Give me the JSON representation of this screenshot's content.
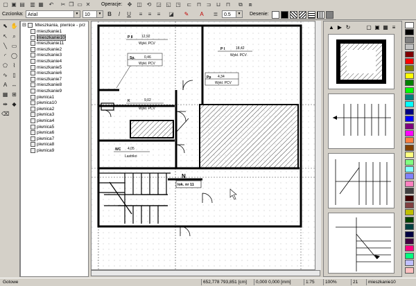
{
  "toolbar": {
    "operations_label": "Operacje:",
    "font_label": "Czcionka:",
    "font_value": "Arial",
    "size_value": "10",
    "line_width_value": "0.5",
    "hatch_label": "Desenie:",
    "bold": "B",
    "italic": "I",
    "underline": "U"
  },
  "tree": {
    "root": "Mieszkania, piwnice - prz",
    "items": [
      "mieszkanie1",
      "mieszkanie10",
      "mieszkanie11",
      "mieszkanie2",
      "mieszkanie3",
      "mieszkanie4",
      "mieszkanie5",
      "mieszkanie6",
      "mieszkanie7",
      "mieszkanie8",
      "mieszkanie9",
      "piwnica1",
      "piwnica10",
      "piwnica2",
      "piwnica3",
      "piwnica4",
      "piwnica5",
      "piwnica6",
      "piwnica7",
      "piwnica8",
      "piwnica9"
    ],
    "selected_index": 1
  },
  "plan": {
    "rooms": [
      {
        "code": "P II",
        "area": "12,92",
        "finish": "Wykł. PCV"
      },
      {
        "code": "P I",
        "area": "18,42",
        "finish": "Wykł. PCV"
      },
      {
        "code": "Sp.",
        "area": "0,46",
        "finish": "Wykł. PCV"
      },
      {
        "code": "Pp",
        "area": "4,34",
        "finish": "Wykł. PCV"
      },
      {
        "code": "K",
        "area": "9,02",
        "finish": "Wykł. PCV"
      },
      {
        "code": "WC",
        "area": "4,05",
        "finish": "Lastriko"
      }
    ],
    "entrance_label": "N",
    "apartment_label": "lok. nr 11"
  },
  "status": {
    "state": "Gotowe",
    "coords": "652,778  793,851 [cm]",
    "offset": "0,000  0,000 [mm]",
    "scale": "1:75",
    "zoom": "100%",
    "count": "21",
    "selected": "mieszkanie10"
  },
  "palette": [
    "#ffffff",
    "#000000",
    "#808080",
    "#c0c0c0",
    "#800000",
    "#ff0000",
    "#808000",
    "#ffff00",
    "#008000",
    "#00ff00",
    "#008080",
    "#00ffff",
    "#000080",
    "#0000ff",
    "#800080",
    "#ff00ff",
    "#ff8040",
    "#804000",
    "#ffff80",
    "#80ff80",
    "#80ffff",
    "#8080ff",
    "#ff80c0",
    "#404040",
    "#400000",
    "#804040",
    "#c0c000",
    "#004000",
    "#004040",
    "#000040",
    "#400040",
    "#ff0080",
    "#00ff80",
    "#c0c0ff",
    "#ffc0c0"
  ]
}
